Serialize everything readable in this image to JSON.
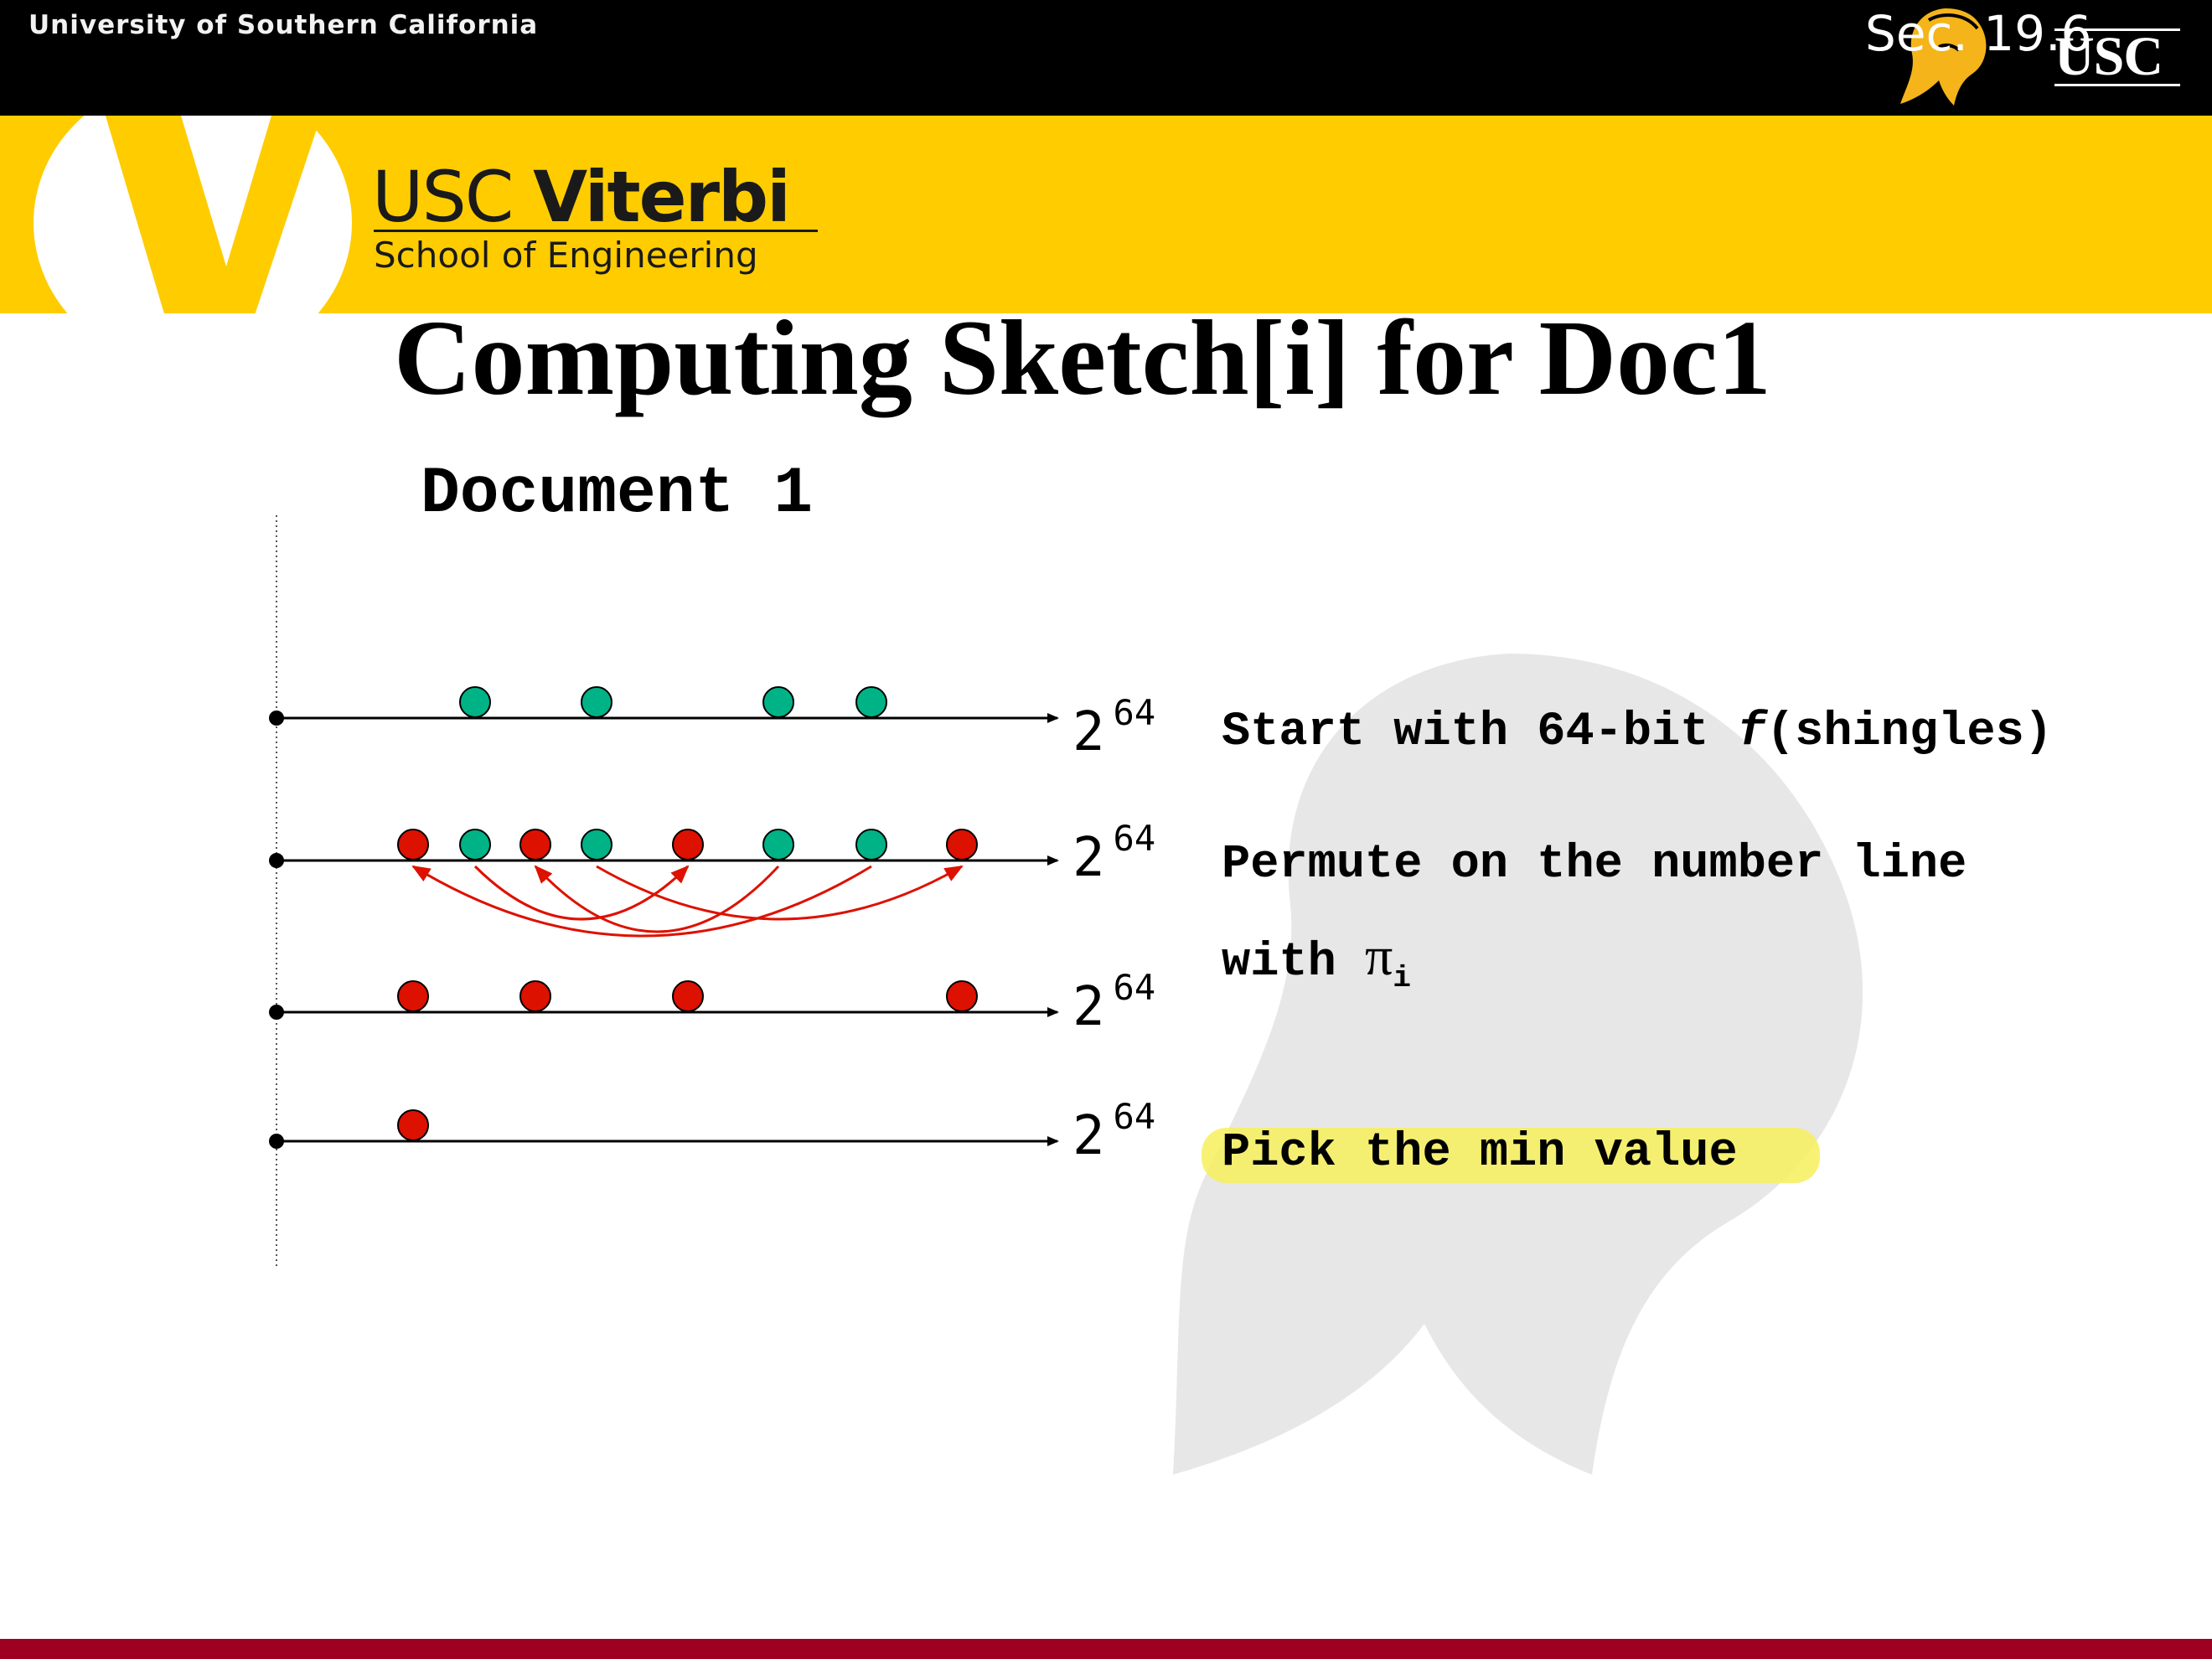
{
  "header": {
    "university": "University of Southern California",
    "section": "Sec. 19.6",
    "usc_logo_text": "USC"
  },
  "brand": {
    "viterbi_prefix": "USC",
    "viterbi_name": "Viterbi",
    "school": "School of Engineering"
  },
  "slide": {
    "title": "Computing Sketch[i] for Doc1",
    "document_label": "Document 1"
  },
  "diagram": {
    "axis_max_base": "2",
    "axis_max_exp": "64",
    "line1_text": "Start with 64-bit ",
    "line1_f": "f",
    "line1_rest": "(shingles)",
    "line2_text": "Permute on the number line",
    "line3_text": "with ",
    "pi_symbol": "π",
    "pi_subscript": "i",
    "line4_text": "Pick the min value"
  },
  "colors": {
    "header_bg": "#000000",
    "band": "#ffcc00",
    "green_dot": "#00b386",
    "red_dot": "#dd1100",
    "highlight": "#f7f05c",
    "footer": "#9d0020"
  }
}
